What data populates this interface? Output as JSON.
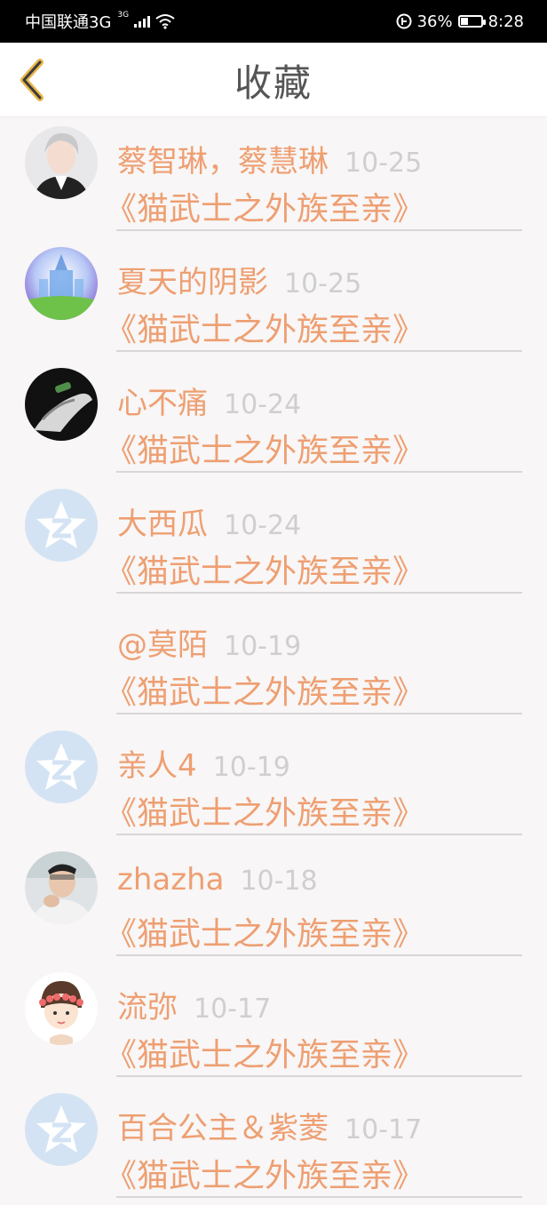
{
  "status_bar": {
    "carrier": "中国联通3G",
    "net_sup": "3G",
    "battery": "36%",
    "battery_level": 0.36,
    "time": "8:28"
  },
  "header": {
    "title": "收藏",
    "back_icon": "chevron-left-icon"
  },
  "colors": {
    "accent": "#ee9f72",
    "date": "#cfcfcf",
    "title": "#555555"
  },
  "items": [
    {
      "name": "蔡智琳，蔡慧琳",
      "date": "10-25",
      "title": "《猫武士之外族至亲》",
      "avatar": "portrait-avatar"
    },
    {
      "name": "夏天的阴影",
      "date": "10-25",
      "title": "《猫武士之外族至亲》",
      "avatar": "castle-avatar"
    },
    {
      "name": "心不痛",
      "date": "10-24",
      "title": "《猫武士之外族至亲》",
      "avatar": "hand-avatar"
    },
    {
      "name": "大西瓜",
      "date": "10-24",
      "title": "《猫武士之外族至亲》",
      "avatar": "qzone-star-avatar"
    },
    {
      "name": "@莫陌",
      "date": "10-19",
      "title": "《猫武士之外族至亲》",
      "avatar": ""
    },
    {
      "name": "亲人4",
      "date": "10-19",
      "title": "《猫武士之外族至亲》",
      "avatar": "qzone-star-avatar"
    },
    {
      "name": "zhazha",
      "date": "10-18",
      "title": "《猫武士之外族至亲》",
      "avatar": "selfie-avatar"
    },
    {
      "name": "流弥",
      "date": "10-17",
      "title": "《猫武士之外族至亲》",
      "avatar": "cartoon-girl-avatar"
    },
    {
      "name": "百合公主＆紫菱",
      "date": "10-17",
      "title": "《猫武士之外族至亲》",
      "avatar": "qzone-star-avatar"
    }
  ]
}
